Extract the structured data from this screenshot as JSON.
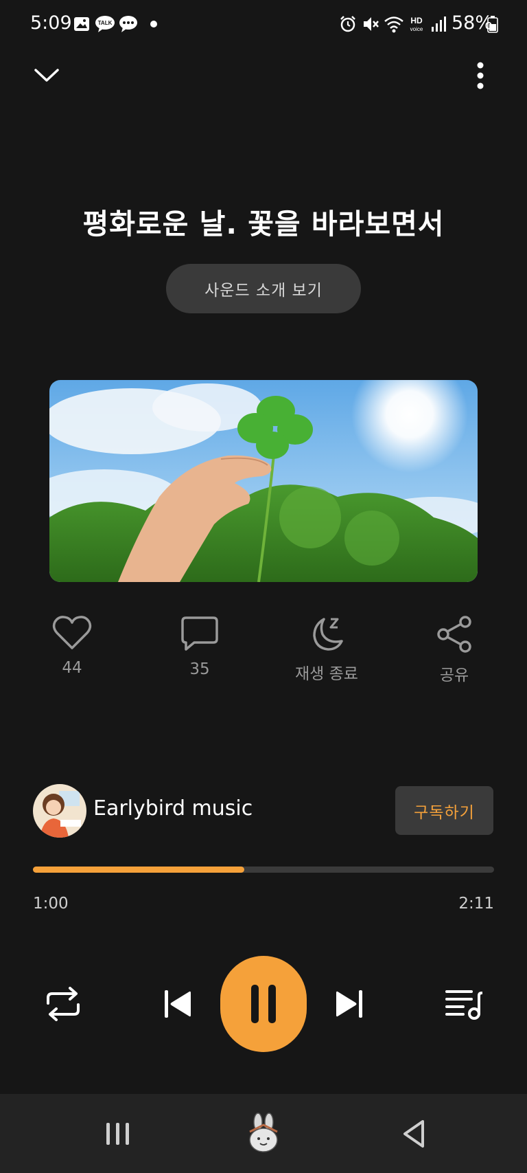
{
  "status_bar": {
    "time": "5:09",
    "battery": "58%",
    "left_icons": [
      "gallery-icon",
      "kakaotalk-icon",
      "chat-icon",
      "dot-icon"
    ],
    "right_icons": [
      "alarm-icon",
      "mute-icon",
      "wifi-icon",
      "hd-voice-icon",
      "signal-icon",
      "battery-icon"
    ]
  },
  "header": {
    "collapse_icon": "chevron-down-icon",
    "menu_icon": "more-vertical-icon"
  },
  "track": {
    "title": "평화로운 날. 꽃을 바라보면서",
    "intro_button_label": "사운드 소개 보기"
  },
  "actions": [
    {
      "icon": "heart-icon",
      "label": "44"
    },
    {
      "icon": "comment-icon",
      "label": "35"
    },
    {
      "icon": "sleep-timer-icon",
      "label": "재생 종료"
    },
    {
      "icon": "share-icon",
      "label": "공유"
    }
  ],
  "channel": {
    "name": "Earlybird music",
    "subscribe_label": "구독하기"
  },
  "progress": {
    "current": "1:00",
    "total": "2:11",
    "fraction": 0.458
  },
  "controls": {
    "repeat_icon": "repeat-icon",
    "prev_icon": "skip-previous-icon",
    "play_icon": "pause-icon",
    "next_icon": "skip-next-icon",
    "playlist_icon": "playlist-icon"
  },
  "colors": {
    "accent": "#f5a13a",
    "background": "#161616"
  }
}
